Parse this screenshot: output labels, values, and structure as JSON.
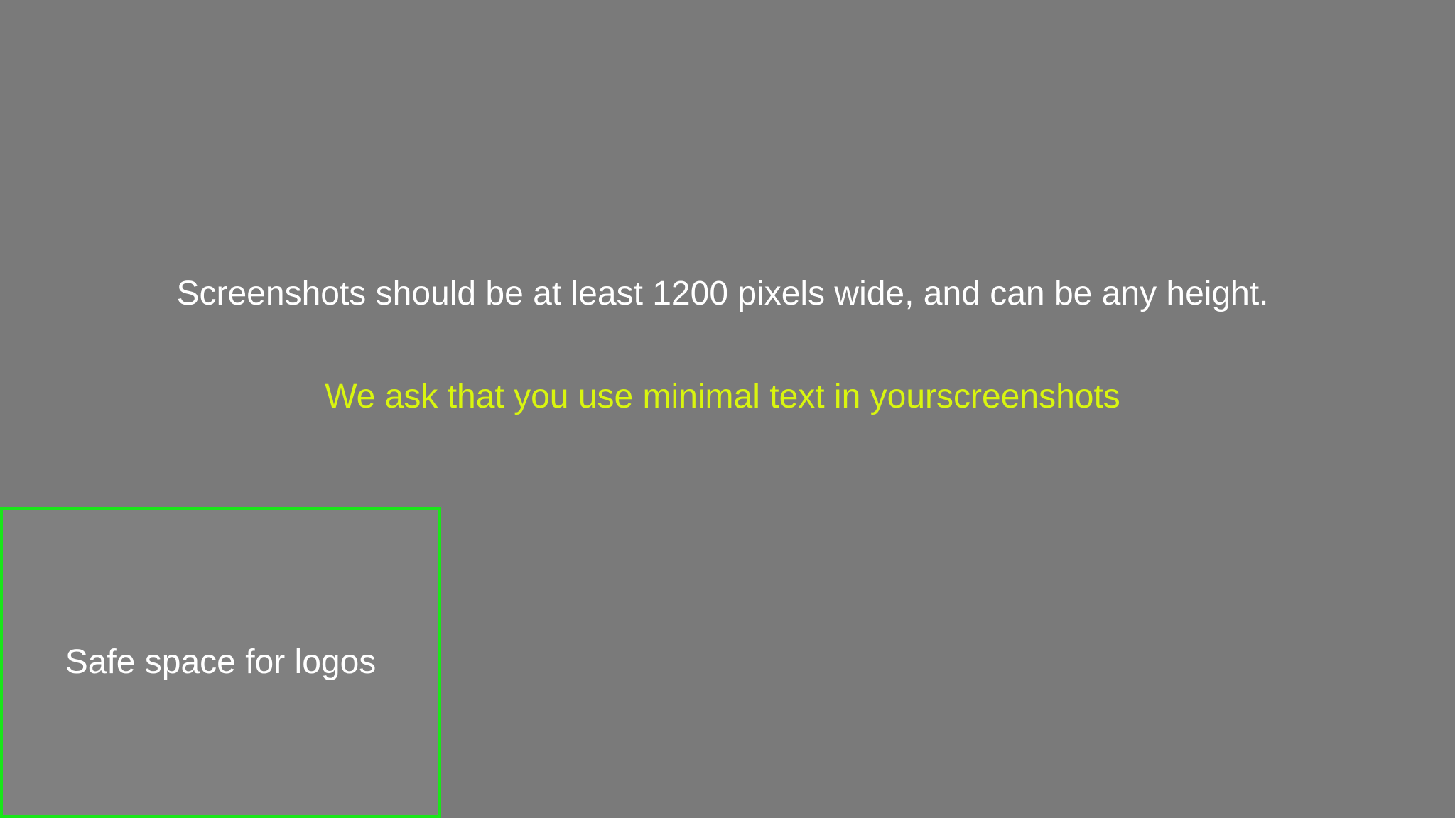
{
  "canvas": {
    "background_color": "#7a7a7a"
  },
  "headline": {
    "text": "Screenshots should be at least 1200 pixels wide, and can be any height.",
    "color": "#ffffff"
  },
  "subline": {
    "text": "We ask that you use minimal text in yourscreenshots",
    "color": "#d9f50f"
  },
  "logo_safe_area": {
    "label": "Safe space for logos",
    "border_color": "#19e619",
    "fill_color": "#808080"
  }
}
